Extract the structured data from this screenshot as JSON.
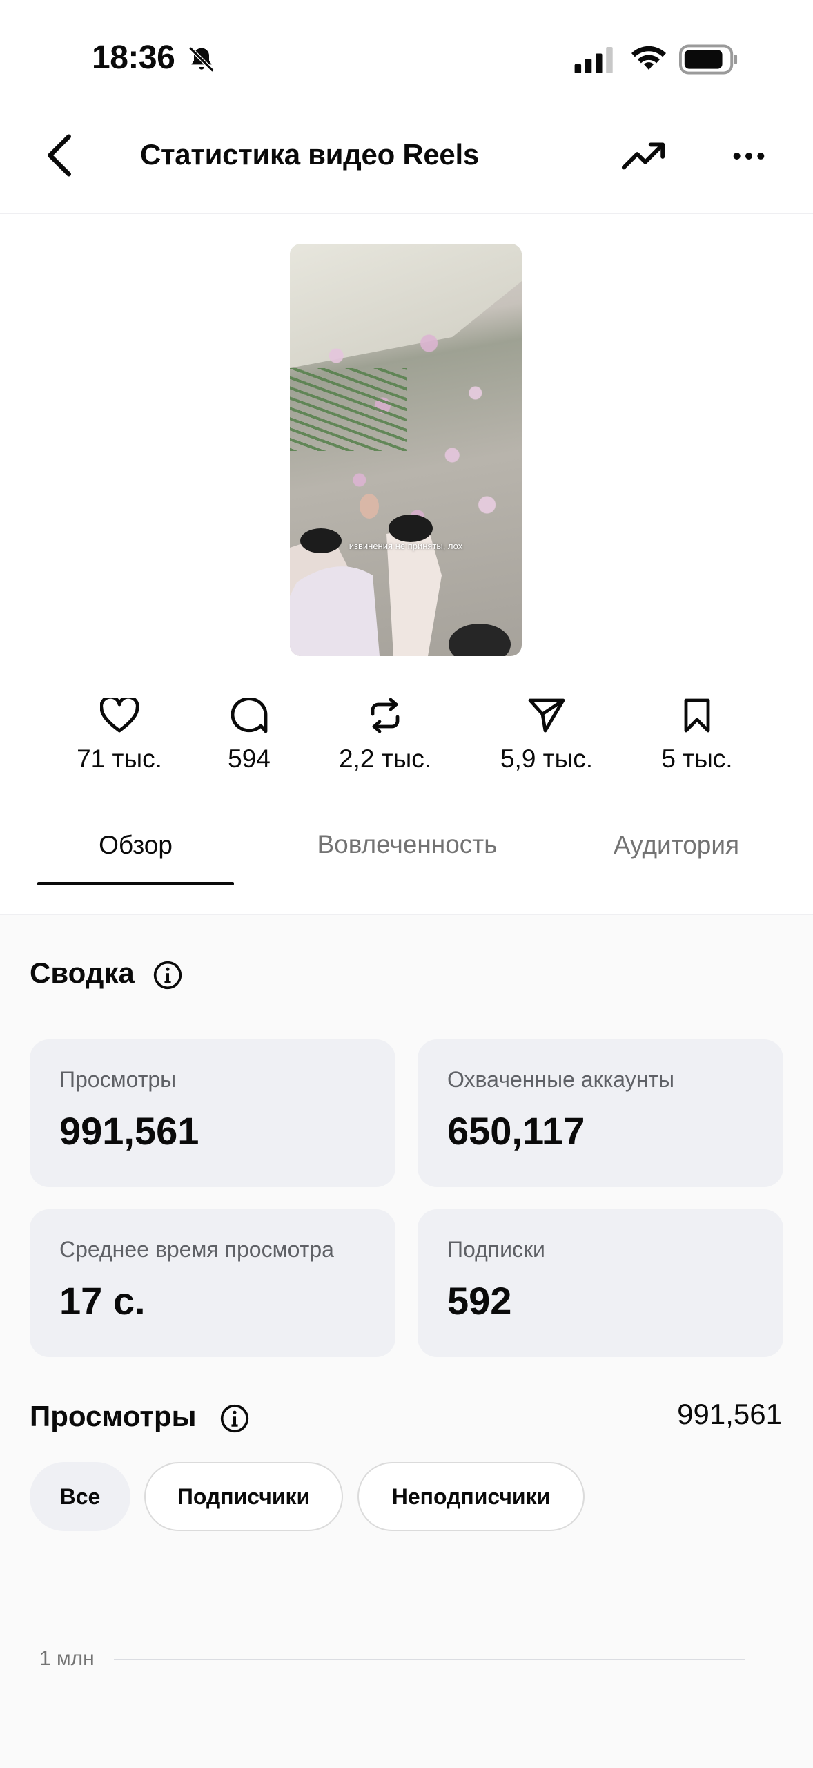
{
  "status_bar": {
    "time": "18:36"
  },
  "header": {
    "title": "Статистика видео Reels"
  },
  "thumbnail": {
    "caption": "извинения не приняты, лох"
  },
  "metrics": [
    {
      "icon": "heart-icon",
      "value": "71 тыс."
    },
    {
      "icon": "comment-icon",
      "value": "594"
    },
    {
      "icon": "repost-icon",
      "value": "2,2 тыс."
    },
    {
      "icon": "share-icon",
      "value": "5,9 тыс."
    },
    {
      "icon": "bookmark-icon",
      "value": "5 тыс."
    }
  ],
  "tabs": [
    {
      "label": "Обзор",
      "active": true
    },
    {
      "label": "Вовлеченность",
      "active": false
    },
    {
      "label": "Аудитория",
      "active": false
    }
  ],
  "summary": {
    "title": "Сводка",
    "cards": [
      {
        "label": "Просмотры",
        "value": "991,561"
      },
      {
        "label": "Охваченные аккаунты",
        "value": "650,117"
      },
      {
        "label": "Среднее время просмотра",
        "value": "17 с."
      },
      {
        "label": "Подписки",
        "value": "592"
      }
    ]
  },
  "views_section": {
    "title": "Просмотры",
    "total": "991,561",
    "filters": [
      {
        "label": "Все",
        "selected": true
      },
      {
        "label": "Подписчики",
        "selected": false
      },
      {
        "label": "Неподписчики",
        "selected": false
      }
    ]
  },
  "chart": {
    "axis_label": "1 млн"
  },
  "colors": {
    "card_bg": "#eff0f4",
    "text": "#0a0a0a",
    "secondary": "#737373"
  }
}
